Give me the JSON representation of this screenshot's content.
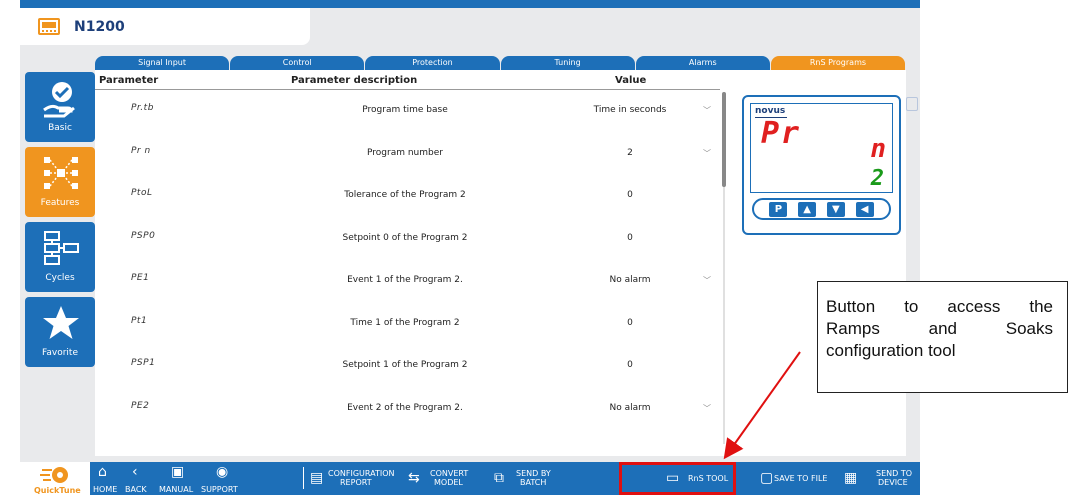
{
  "app": {
    "title": "N1200"
  },
  "sidebar": [
    {
      "name": "basic",
      "label": "Basic",
      "active": false
    },
    {
      "name": "features",
      "label": "Features",
      "active": true
    },
    {
      "name": "cycles",
      "label": "Cycles",
      "active": false
    },
    {
      "name": "favorite",
      "label": "Favorite",
      "active": false
    }
  ],
  "tabs": [
    {
      "label": "Signal Input",
      "active": false
    },
    {
      "label": "Control",
      "active": false
    },
    {
      "label": "Protection",
      "active": false
    },
    {
      "label": "Tuning",
      "active": false
    },
    {
      "label": "Alarms",
      "active": false
    },
    {
      "label": "RnS Programs",
      "active": true
    }
  ],
  "table": {
    "headers": {
      "parameter": "Parameter",
      "description": "Parameter description",
      "value": "Value"
    },
    "rows": [
      {
        "code": "Pr.tb",
        "description": "Program time base",
        "value": "Time in seconds",
        "dropdown": true
      },
      {
        "code": "Pr  n",
        "description": "Program number",
        "value": "2",
        "dropdown": true
      },
      {
        "code": "PtoL",
        "description": "Tolerance of the Program 2",
        "value": "0",
        "dropdown": false
      },
      {
        "code": "PSP0",
        "description": "Setpoint 0 of the Program 2",
        "value": "0",
        "dropdown": false
      },
      {
        "code": "PE1",
        "description": "Event 1 of the Program 2.",
        "value": "No alarm",
        "dropdown": true
      },
      {
        "code": "Pt1",
        "description": "Time 1 of the Program 2",
        "value": "0",
        "dropdown": false
      },
      {
        "code": "PSP1",
        "description": "Setpoint 1 of the Program 2",
        "value": "0",
        "dropdown": false
      },
      {
        "code": "PE2",
        "description": "Event 2 of the Program 2.",
        "value": "No alarm",
        "dropdown": true
      }
    ]
  },
  "device": {
    "brand": "novus",
    "display_top_left": "Pr",
    "display_top_right": "n",
    "display_bottom": "2",
    "keys": [
      "P",
      "▲",
      "▼",
      "◀"
    ]
  },
  "bottom_bar": {
    "logo": "QuickTune",
    "home": "HOME",
    "back": "BACK",
    "manual": "MANUAL",
    "support": "SUPPORT",
    "configuration_report": [
      "CONFIGURATION",
      "REPORT"
    ],
    "convert_model": [
      "CONVERT",
      "MODEL"
    ],
    "send_by_batch": [
      "SEND BY",
      "BATCH"
    ],
    "rns_tool": "RnS TOOL",
    "save_to_file": "SAVE TO FILE",
    "send_to_device": [
      "SEND TO",
      "DEVICE"
    ]
  },
  "callout": {
    "lines": [
      "Button to access the",
      "Ramps and Soaks",
      "configuration tool"
    ]
  },
  "colors": {
    "primary": "#1d6fb8",
    "accent": "#f0951f",
    "highlight": "#e01010"
  }
}
